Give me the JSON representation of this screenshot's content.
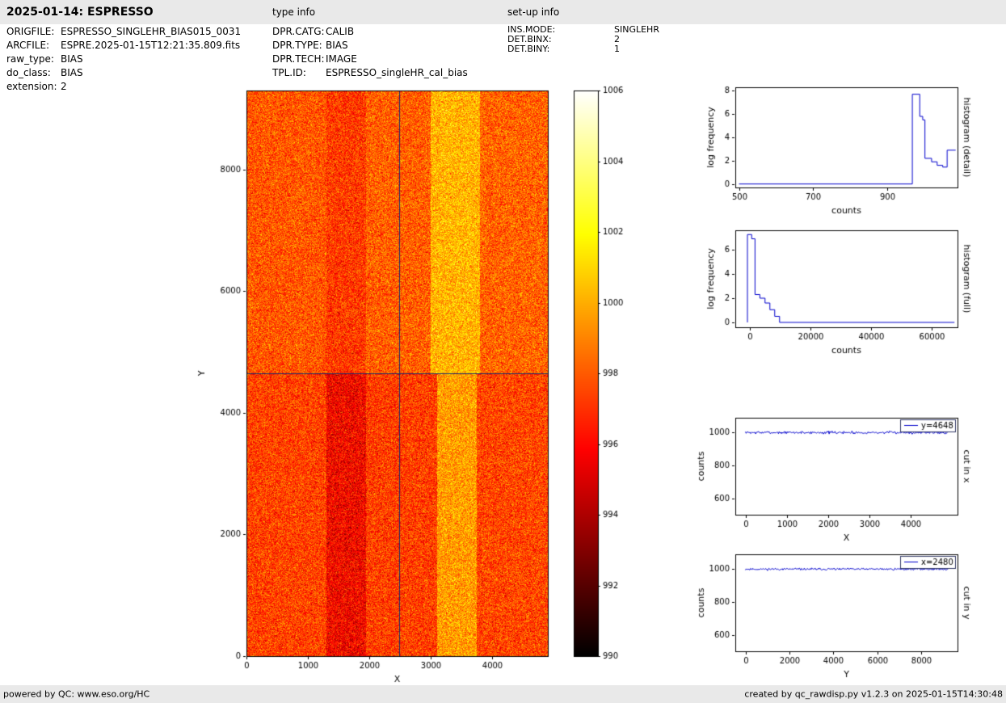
{
  "header": {
    "title": "2025-01-14: ESPRESSO",
    "type_info_label": "type info",
    "setup_info_label": "set-up info"
  },
  "file_info": {
    "rows": [
      {
        "label": "ORIGFILE:",
        "value": "ESPRESSO_SINGLEHR_BIAS015_0031"
      },
      {
        "label": "ARCFILE:",
        "value": "ESPRE.2025-01-15T12:21:35.809.fits"
      },
      {
        "label": "raw_type:",
        "value": "BIAS"
      },
      {
        "label": "do_class:",
        "value": "BIAS"
      },
      {
        "label": "extension:",
        "value": "2"
      }
    ]
  },
  "type_info": {
    "rows": [
      {
        "label": "DPR.CATG:",
        "value": "CALIB"
      },
      {
        "label": "DPR.TYPE:",
        "value": "BIAS"
      },
      {
        "label": "DPR.TECH:",
        "value": "IMAGE"
      },
      {
        "label": "TPL.ID:",
        "value": "ESPRESSO_singleHR_cal_bias"
      }
    ]
  },
  "setup_info": {
    "rows": [
      {
        "label": "INS.MODE:",
        "value": "SINGLEHR"
      },
      {
        "label": "DET.BINX:",
        "value": "2"
      },
      {
        "label": "DET.BINY:",
        "value": "1"
      }
    ]
  },
  "footer": {
    "left": "powered by QC: www.eso.org/HC",
    "right": "created by qc_rawdisp.py v1.2.3 on 2025-01-15T14:30:48"
  },
  "colors": {
    "line": "#0000cc",
    "crosshair": "#1b2a6b",
    "frame": "#000000",
    "bar_background": "#e9e9e9"
  },
  "chart_data": [
    {
      "id": "bias-image",
      "type": "heatmap",
      "xlabel": "X",
      "ylabel": "Y",
      "xlim": [
        0,
        4900
      ],
      "ylim": [
        0,
        9300
      ],
      "xticks": [
        0,
        1000,
        2000,
        3000,
        4000
      ],
      "yticks": [
        0,
        2000,
        4000,
        6000,
        8000
      ],
      "colormap": "hot",
      "vmin": 990,
      "vmax": 1006,
      "colorbar_ticks": [
        990,
        992,
        994,
        996,
        998,
        1000,
        1002,
        1004,
        1006
      ],
      "crosshair": {
        "x": 2480,
        "y": 4648
      },
      "noise_sigma": 1.25,
      "regions": [
        {
          "y_from": 4648,
          "y_to": 9301,
          "bands": [
            {
              "x_from": 0,
              "x_to": 1300,
              "level": 997.9
            },
            {
              "x_from": 1300,
              "x_to": 1950,
              "level": 997.2
            },
            {
              "x_from": 1950,
              "x_to": 3000,
              "level": 998.1
            },
            {
              "x_from": 3000,
              "x_to": 3800,
              "level": 1000.2
            },
            {
              "x_from": 3800,
              "x_to": 4900,
              "level": 998.2
            }
          ]
        },
        {
          "y_from": 0,
          "y_to": 4648,
          "bands": [
            {
              "x_from": 0,
              "x_to": 1300,
              "level": 997.4
            },
            {
              "x_from": 1300,
              "x_to": 1950,
              "level": 995.8
            },
            {
              "x_from": 1950,
              "x_to": 3100,
              "level": 997.3
            },
            {
              "x_from": 3100,
              "x_to": 3750,
              "level": 999.6
            },
            {
              "x_from": 3750,
              "x_to": 4900,
              "level": 997.5
            }
          ]
        }
      ]
    },
    {
      "id": "hist-detail",
      "type": "line",
      "xlabel": "counts",
      "ylabel": "log frequency",
      "right_label": "histogram (detail)",
      "xlim": [
        490,
        1090
      ],
      "ylim": [
        -0.3,
        8.3
      ],
      "xticks": [
        500,
        700,
        900
      ],
      "yticks": [
        0,
        2,
        4,
        6,
        8
      ],
      "points": [
        [
          500,
          0
        ],
        [
          968,
          0
        ],
        [
          968,
          7.7
        ],
        [
          988,
          7.7
        ],
        [
          988,
          5.8
        ],
        [
          996,
          5.8
        ],
        [
          996,
          5.5
        ],
        [
          1002,
          5.5
        ],
        [
          1002,
          2.2
        ],
        [
          1020,
          2.2
        ],
        [
          1020,
          1.9
        ],
        [
          1035,
          1.9
        ],
        [
          1035,
          1.6
        ],
        [
          1050,
          1.6
        ],
        [
          1050,
          1.45
        ],
        [
          1062,
          1.45
        ],
        [
          1062,
          2.9
        ],
        [
          1085,
          2.9
        ]
      ]
    },
    {
      "id": "hist-full",
      "type": "line",
      "xlabel": "counts",
      "ylabel": "log frequency",
      "right_label": "histogram (full)",
      "xlim": [
        -4800,
        68500
      ],
      "ylim": [
        -0.4,
        7.6
      ],
      "xticks": [
        0,
        20000,
        40000,
        60000
      ],
      "yticks": [
        0,
        2,
        4,
        6
      ],
      "points": [
        [
          -800,
          0
        ],
        [
          -800,
          7.25
        ],
        [
          600,
          7.25
        ],
        [
          600,
          6.9
        ],
        [
          1700,
          6.9
        ],
        [
          1700,
          2.3
        ],
        [
          3300,
          2.3
        ],
        [
          3300,
          2.0
        ],
        [
          5000,
          2.0
        ],
        [
          5000,
          1.6
        ],
        [
          6600,
          1.6
        ],
        [
          6600,
          1.05
        ],
        [
          8200,
          1.05
        ],
        [
          8200,
          0.5
        ],
        [
          9800,
          0.5
        ],
        [
          9800,
          0
        ],
        [
          67500,
          0
        ]
      ]
    },
    {
      "id": "cut-x",
      "type": "noisy-line",
      "xlabel": "X",
      "ylabel": "counts",
      "right_label": "cut in x",
      "legend": "y=4648",
      "xlim": [
        -245,
        5145
      ],
      "ylim": [
        500,
        1090
      ],
      "xticks": [
        0,
        1000,
        2000,
        3000,
        4000
      ],
      "yticks": [
        600,
        800,
        1000
      ],
      "x_from": 0,
      "x_to": 4900,
      "mean": 1000,
      "sigma": 4,
      "seed": 7
    },
    {
      "id": "cut-y",
      "type": "noisy-line",
      "xlabel": "Y",
      "ylabel": "counts",
      "right_label": "cut in y",
      "legend": "x=2480",
      "xlim": [
        -460,
        9650
      ],
      "ylim": [
        500,
        1090
      ],
      "xticks": [
        0,
        2000,
        4000,
        6000,
        8000
      ],
      "yticks": [
        600,
        800,
        1000
      ],
      "x_from": 0,
      "x_to": 9216,
      "mean": 1000,
      "sigma": 3,
      "seed": 11
    }
  ]
}
